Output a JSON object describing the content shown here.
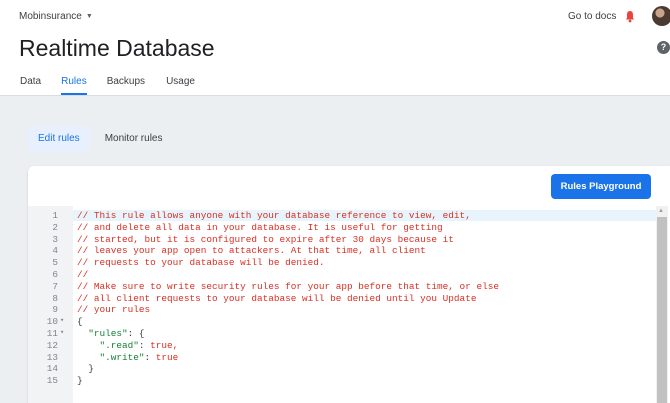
{
  "header": {
    "project_name": "Mobinsurance",
    "go_to_docs": "Go to docs",
    "page_title": "Realtime Database",
    "help_icon": "?",
    "icons": {
      "dropdown": "caret-down",
      "notifications": "bell",
      "help": "help-circle",
      "account": "avatar"
    }
  },
  "tabs": [
    {
      "label": "Data"
    },
    {
      "label": "Rules"
    },
    {
      "label": "Backups"
    },
    {
      "label": "Usage"
    }
  ],
  "active_tab": "Rules",
  "subtabs": [
    {
      "label": "Edit rules"
    },
    {
      "label": "Monitor rules"
    }
  ],
  "active_subtab": "Edit rules",
  "editor": {
    "playground_button": "Rules Playground",
    "line_numbers": [
      "1",
      "2",
      "3",
      "4",
      "5",
      "6",
      "7",
      "8",
      "9",
      "10",
      "11",
      "12",
      "13",
      "14",
      "15"
    ],
    "fold_markers": [
      "",
      "",
      "",
      "",
      "",
      "",
      "",
      "",
      "",
      "▾",
      "▾",
      "",
      "",
      "",
      ""
    ],
    "lines": [
      "// This rule allows anyone with your database reference to view, edit,",
      "// and delete all data in your database. It is useful for getting",
      "// started, but it is configured to expire after 30 days because it",
      "// leaves your app open to attackers. At that time, all client",
      "// requests to your database will be denied.",
      "//",
      "// Make sure to write security rules for your app before that time, or else",
      "// all client requests to your database will be denied until you Update",
      "// your rules",
      "{",
      "  \"rules\": {",
      "    \".read\": true,",
      "    \".write\": true",
      "  }",
      "}"
    ]
  },
  "colors": {
    "accent": "#1a73e8",
    "comment": "#d93025",
    "string_key": "#188038",
    "notification": "#e8453c"
  }
}
